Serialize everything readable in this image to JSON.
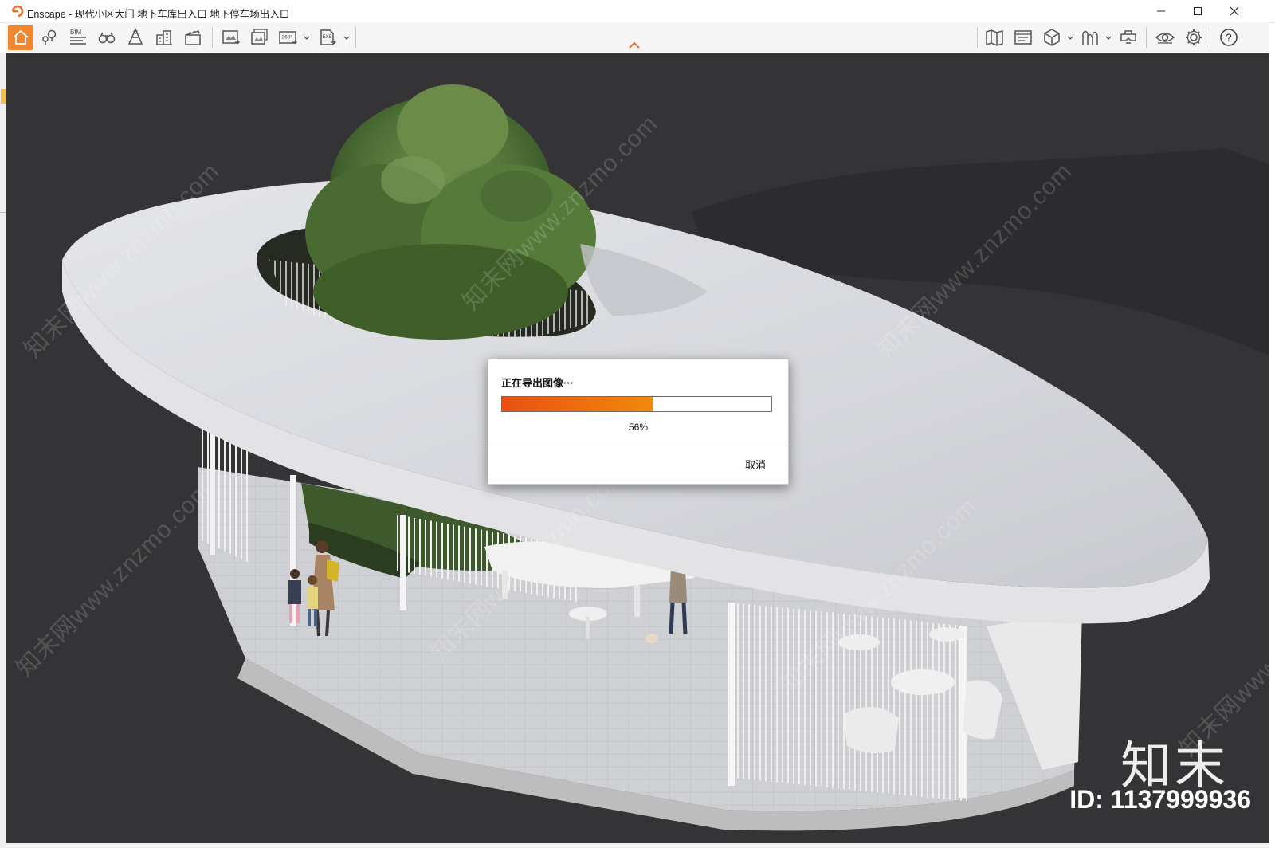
{
  "window": {
    "title": "Enscape - 现代小区大门 地下车库出入口 地下停车场出入口",
    "controls": [
      "minimize",
      "maximize",
      "close"
    ]
  },
  "toolbar": {
    "left_tools": [
      {
        "icon": "home-icon",
        "active": true
      },
      {
        "icon": "location-pins-icon"
      },
      {
        "icon": "bim-icon",
        "label": "BIM"
      },
      {
        "icon": "binoculars-icon"
      },
      {
        "icon": "cone-asset-icon"
      },
      {
        "icon": "buildings-icon"
      },
      {
        "icon": "clapperboard-icon"
      },
      {
        "icon": "screenshot-export-icon"
      },
      {
        "icon": "batch-export-icon"
      },
      {
        "icon": "panorama-360-icon",
        "label": "360°",
        "dropdown": true
      },
      {
        "icon": "exe-export-icon",
        "label": "EXE",
        "dropdown": true
      }
    ],
    "right_tools": [
      {
        "icon": "map-icon"
      },
      {
        "icon": "view-management-icon"
      },
      {
        "icon": "cube-view-icon",
        "dropdown": true
      },
      {
        "icon": "path-walk-icon",
        "dropdown": true
      },
      {
        "icon": "vr-headset-icon"
      },
      {
        "icon": "eye-visibility-icon"
      },
      {
        "icon": "gear-icon"
      },
      {
        "icon": "help-icon",
        "label": "?"
      }
    ],
    "accent_color": "#f0862f"
  },
  "dialog": {
    "title": "正在导出图像···",
    "progress": 0.56,
    "progress_label": "56%",
    "cancel_label": "取消",
    "bar_colors": [
      "#ea4f12",
      "#f08a0a"
    ]
  },
  "watermark": {
    "repeated_text": "知末网www.znzmo.com",
    "brand": "知末",
    "id_label": "ID: 1137999936"
  }
}
